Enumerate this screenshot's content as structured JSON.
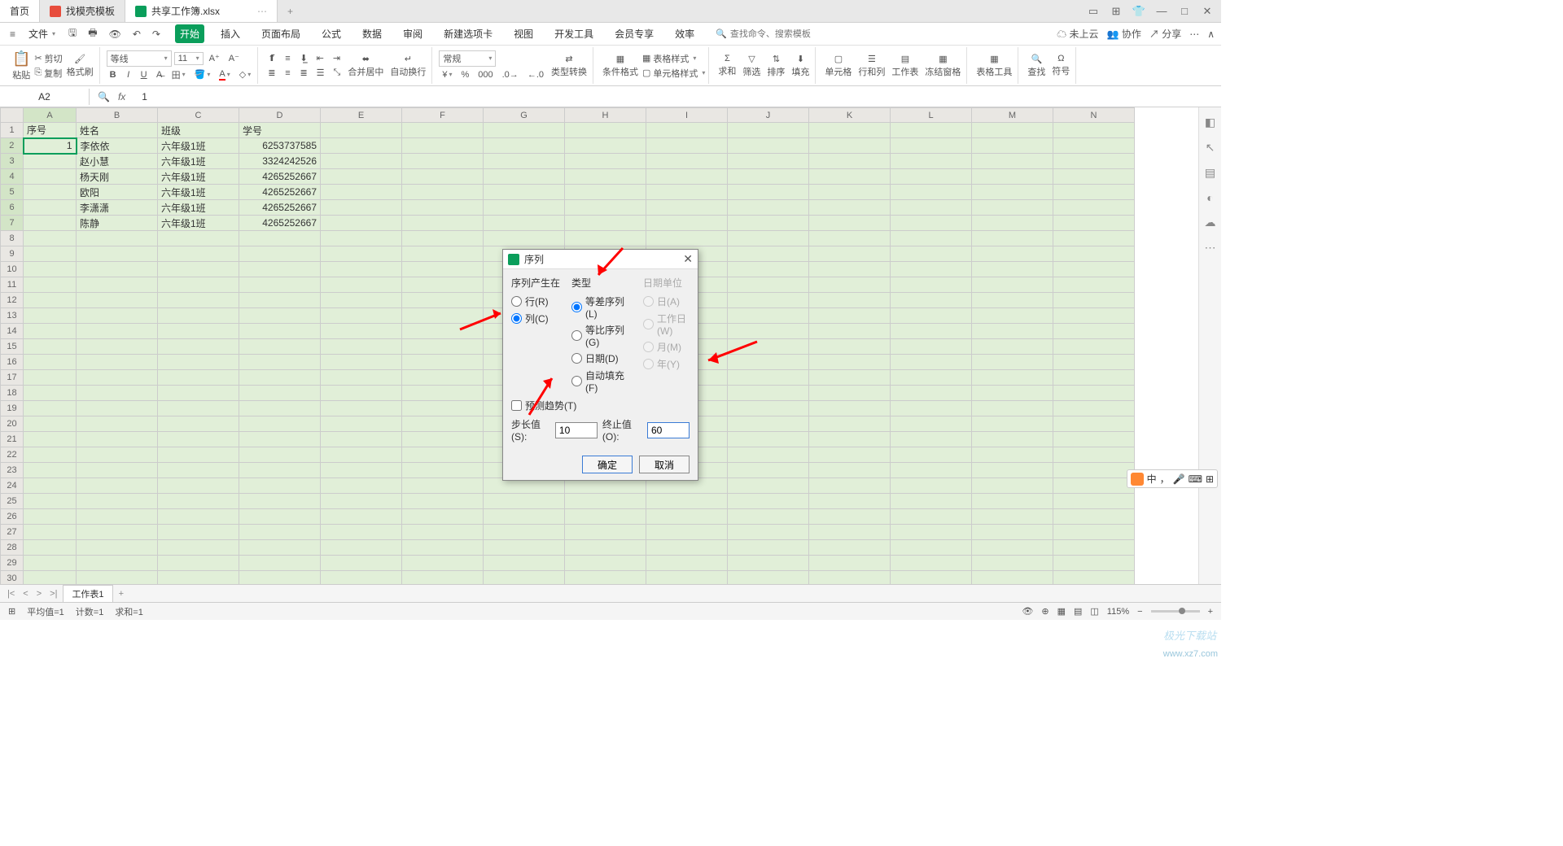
{
  "titlebar": {
    "home": "首页",
    "tab1": "找模壳模板",
    "tab2": "共享工作簿.xlsx",
    "add": "+"
  },
  "menubar": {
    "file": "文件",
    "quick": [
      "☰",
      "⎙",
      "↶",
      "↷"
    ],
    "tabs": [
      "开始",
      "插入",
      "页面布局",
      "公式",
      "数据",
      "审阅",
      "新建选项卡",
      "视图",
      "开发工具",
      "会员专享",
      "效率"
    ],
    "activeTab": 0,
    "search_placeholder": "查找命令、搜索模板",
    "right": {
      "cloud": "未上云",
      "coop": "协作",
      "share": "分享"
    }
  },
  "ribbon": {
    "paste": "粘贴",
    "cut": "剪切",
    "copy": "复制",
    "brush": "格式刷",
    "fontName": "等线",
    "fontSize": "11",
    "mergeCenter": "合并居中",
    "wrap": "自动换行",
    "numFmt": "常规",
    "typeConv": "类型转换",
    "condFmt": "条件格式",
    "tblStyle": "表格样式",
    "cellStyle": "单元格样式",
    "sum": "求和",
    "filter": "筛选",
    "sort": "排序",
    "fill": "填充",
    "cell": "单元格",
    "rowscols": "行和列",
    "worksheet": "工作表",
    "freeze": "冻结窗格",
    "tblTool": "表格工具",
    "find": "查找",
    "symbol": "符号"
  },
  "fxbar": {
    "name": "A2",
    "fx": "fx",
    "formula": "1"
  },
  "columns": [
    "",
    "A",
    "B",
    "C",
    "D",
    "E",
    "F",
    "G",
    "H",
    "I",
    "J",
    "K",
    "L",
    "M",
    "N"
  ],
  "rowCount": 34,
  "header_row": [
    "序号",
    "姓名",
    "班级",
    "学号"
  ],
  "data_rows": [
    {
      "a": "1",
      "b": "李依依",
      "c": "六年级1班",
      "d": "6253737585"
    },
    {
      "a": "",
      "b": "赵小慧",
      "c": "六年级1班",
      "d": "3324242526"
    },
    {
      "a": "",
      "b": "杨天刚",
      "c": "六年级1班",
      "d": "4265252667"
    },
    {
      "a": "",
      "b": "欧阳",
      "c": "六年级1班",
      "d": "4265252667"
    },
    {
      "a": "",
      "b": "李潇潇",
      "c": "六年级1班",
      "d": "4265252667"
    },
    {
      "a": "",
      "b": "陈静",
      "c": "六年级1班",
      "d": "4265252667"
    }
  ],
  "dialog": {
    "title": "序列",
    "groups": {
      "gen": "序列产生在",
      "type": "类型",
      "unit": "日期单位"
    },
    "gen": {
      "row": "行(R)",
      "col": "列(C)"
    },
    "type": {
      "arith": "等差序列(L)",
      "geom": "等比序列(G)",
      "date": "日期(D)",
      "auto": "自动填充(F)"
    },
    "unit": {
      "day": "日(A)",
      "wday": "工作日(W)",
      "month": "月(M)",
      "year": "年(Y)"
    },
    "trend": "预测趋势(T)",
    "step_lbl": "步长值(S):",
    "step_val": "10",
    "stop_lbl": "终止值(O):",
    "stop_val": "60",
    "ok": "确定",
    "cancel": "取消"
  },
  "sheettabs": {
    "name": "工作表1"
  },
  "statusbar": {
    "avg": "平均值=1",
    "count": "计数=1",
    "sum": "求和=1",
    "zoom": "115%"
  },
  "watermark1": "极光下载站",
  "watermark2": "www.xz7.com",
  "ime": {
    "lang": "中"
  }
}
